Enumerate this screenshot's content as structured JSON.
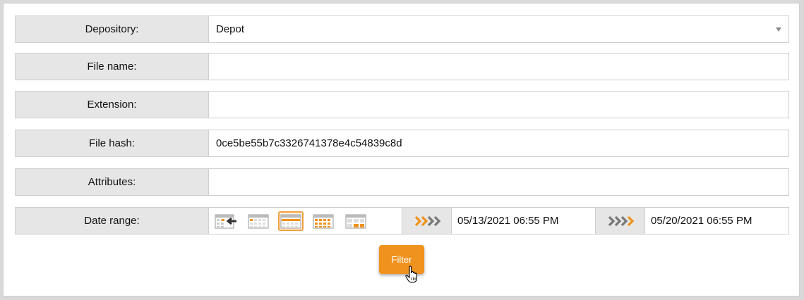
{
  "form": {
    "depository": {
      "label": "Depository:",
      "value": "Depot"
    },
    "file_name": {
      "label": "File name:",
      "value": ""
    },
    "extension": {
      "label": "Extension:",
      "value": ""
    },
    "file_hash": {
      "label": "File hash:",
      "value": "0ce5be55b7c3326741378e4c54839c8d"
    },
    "attributes": {
      "label": "Attributes:",
      "value": ""
    },
    "date_range": {
      "label": "Date range:",
      "presets": [
        "previous-period-calendar-icon",
        "day-calendar-icon",
        "week-calendar-icon",
        "month-calendar-icon",
        "custom-calendar-icon"
      ],
      "active_preset": "week-calendar-icon",
      "from": "05/13/2021 06:55 PM",
      "to": "05/20/2021 06:55 PM"
    }
  },
  "filter_button": {
    "label": "Filter"
  },
  "colors": {
    "accent": "#f0921e",
    "label_bg": "#e6e6e6",
    "border": "#cfcfcf",
    "arrow_from": "#f0921e",
    "arrow_to_grey": "#777777"
  }
}
